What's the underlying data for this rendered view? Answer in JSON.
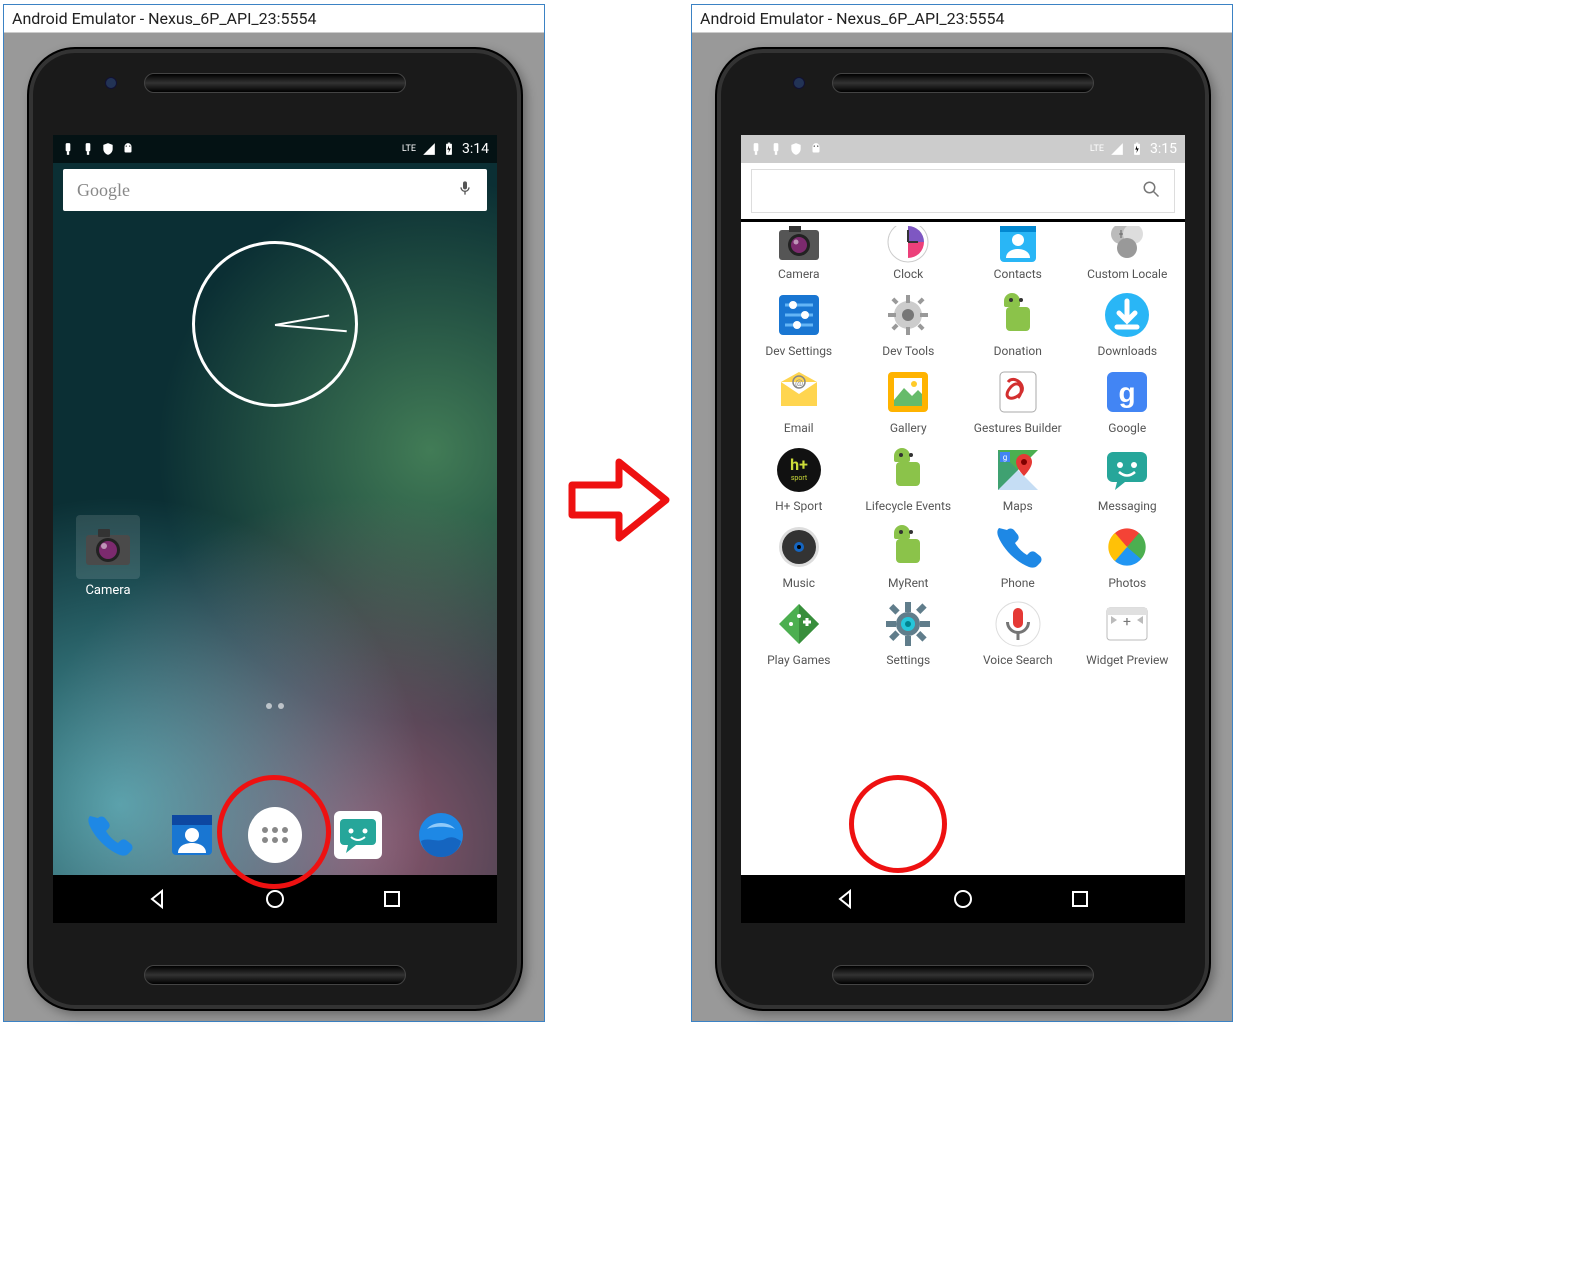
{
  "windows": {
    "left": {
      "title": "Android Emulator - Nexus_6P_API_23:5554",
      "time": "3:14",
      "lte": "LTE"
    },
    "right": {
      "title": "Android Emulator - Nexus_6P_API_23:5554",
      "time": "3:15",
      "lte": "LTE"
    }
  },
  "home": {
    "search_placeholder": "Google",
    "camera_label": "Camera"
  },
  "drawer": {
    "apps": [
      {
        "name": "Camera"
      },
      {
        "name": "Clock"
      },
      {
        "name": "Contacts"
      },
      {
        "name": "Custom Locale"
      },
      {
        "name": "Dev Settings"
      },
      {
        "name": "Dev Tools"
      },
      {
        "name": "Donation"
      },
      {
        "name": "Downloads"
      },
      {
        "name": "Email"
      },
      {
        "name": "Gallery"
      },
      {
        "name": "Gestures Builder"
      },
      {
        "name": "Google"
      },
      {
        "name": "H+ Sport"
      },
      {
        "name": "Lifecycle Events"
      },
      {
        "name": "Maps"
      },
      {
        "name": "Messaging"
      },
      {
        "name": "Music"
      },
      {
        "name": "MyRent"
      },
      {
        "name": "Phone"
      },
      {
        "name": "Photos"
      },
      {
        "name": "Play Games"
      },
      {
        "name": "Settings"
      },
      {
        "name": "Voice Search"
      },
      {
        "name": "Widget Preview"
      }
    ]
  },
  "highlights": {
    "app_drawer_button": true,
    "settings_app": true
  }
}
